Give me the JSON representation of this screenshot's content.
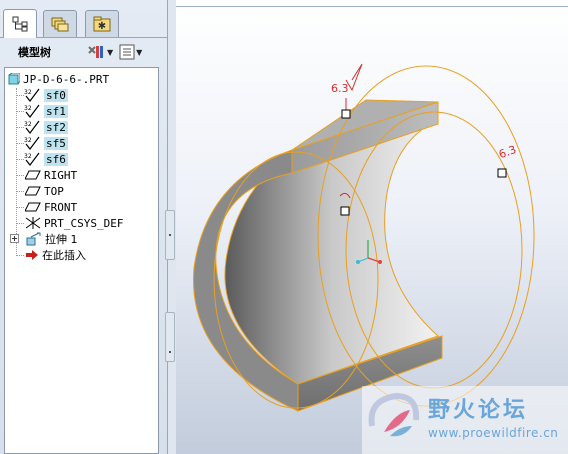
{
  "model_tree": {
    "title": "模型树",
    "items": [
      {
        "label": "JP-D-6-6-.PRT",
        "icon": "part-icon",
        "selected": false
      },
      {
        "label": "sf0",
        "icon": "surface-finish-icon",
        "prefix": "32",
        "selected": true
      },
      {
        "label": "sf1",
        "icon": "surface-finish-icon",
        "prefix": "32",
        "selected": true
      },
      {
        "label": "sf2",
        "icon": "surface-finish-icon",
        "prefix": "32",
        "selected": true
      },
      {
        "label": "sf5",
        "icon": "surface-finish-icon",
        "prefix": "32",
        "selected": true
      },
      {
        "label": "sf6",
        "icon": "surface-finish-icon",
        "prefix": "32",
        "selected": true
      },
      {
        "label": "RIGHT",
        "icon": "datum-plane-icon",
        "selected": false
      },
      {
        "label": "TOP",
        "icon": "datum-plane-icon",
        "selected": false
      },
      {
        "label": "FRONT",
        "icon": "datum-plane-icon",
        "selected": false
      },
      {
        "label": "PRT_CSYS_DEF",
        "icon": "coordinate-system-icon",
        "selected": false
      },
      {
        "label": "拉伸 1",
        "icon": "extrude-icon",
        "expandable": true,
        "selected": false
      },
      {
        "label": "在此插入",
        "icon": "insert-here-arrow-icon",
        "selected": false
      }
    ]
  },
  "tabs": [
    {
      "name": "model-tree-tab",
      "icon": "tree-icon",
      "active": true
    },
    {
      "name": "folder-browser-tab",
      "icon": "folders-icon",
      "active": false
    },
    {
      "name": "favorites-tab",
      "icon": "favorites-star-icon",
      "active": false
    }
  ],
  "toolbar": {
    "settings_icon": "tools-icon",
    "show_icon": "show-columns-icon"
  },
  "annotations": [
    {
      "text": "6.3",
      "color": "#d03030"
    },
    {
      "text": "6.3",
      "color": "#d03030"
    }
  ],
  "colors": {
    "model_edge": "#e8a020",
    "annotation": "#d03030",
    "selection_highlight": "#bfe3ee",
    "watermark": "#6aa6d9"
  },
  "watermark": {
    "name": "野火论坛",
    "url": "www.proewildfire.cn"
  }
}
